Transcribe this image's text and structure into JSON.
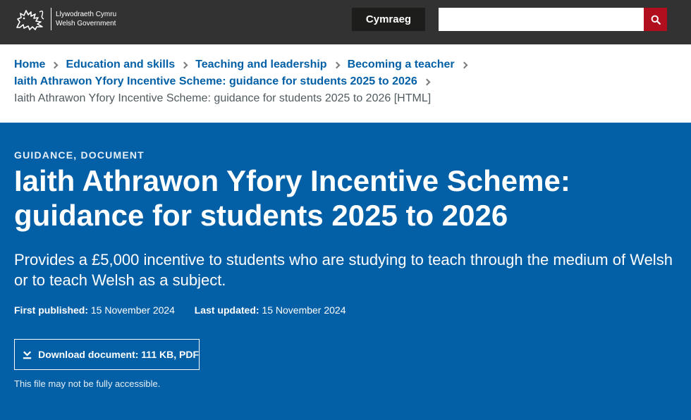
{
  "header": {
    "logo_line1": "Llywodraeth Cymru",
    "logo_line2": "Welsh Government",
    "language_button": "Cymraeg",
    "search_value": "",
    "colors": {
      "background": "#323232",
      "search_button": "#b10e1e"
    }
  },
  "breadcrumb": {
    "items": [
      {
        "label": "Home"
      },
      {
        "label": "Education and skills"
      },
      {
        "label": "Teaching and leadership"
      },
      {
        "label": "Becoming a teacher"
      },
      {
        "label": "Iaith Athrawon Yfory Incentive Scheme: guidance for students 2025 to 2026"
      }
    ],
    "current": "Iaith Athrawon Yfory Incentive Scheme: guidance for students 2025 to 2026 [HTML]"
  },
  "hero": {
    "doc_type": "GUIDANCE, DOCUMENT",
    "title": "Iaith Athrawon Yfory Incentive Scheme: guidance for students 2025 to 2026",
    "summary": "Provides a £5,000 incentive to students who are studying to teach through the medium of Welsh or to teach Welsh as a subject.",
    "first_published_label": "First published:",
    "first_published_value": "15 November 2024",
    "last_updated_label": "Last updated:",
    "last_updated_value": "15 November 2024",
    "download_label": "Download document: 111 KB, PDF",
    "access_note": "This file may not be fully accessible.",
    "colors": {
      "background": "#0360a6"
    }
  },
  "icons": {
    "logo": "welsh-dragon-icon",
    "search": "search-icon",
    "separator": "chevron-right-icon",
    "download": "download-icon"
  }
}
